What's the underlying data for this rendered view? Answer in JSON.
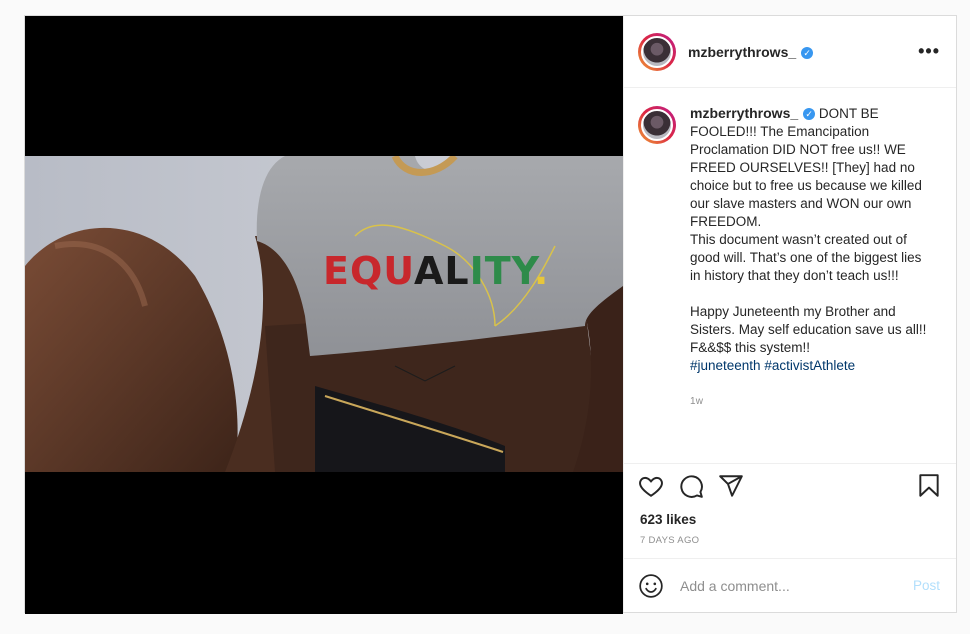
{
  "post": {
    "username": "mzberrythrows_",
    "caption_text": "DONT BE FOOLED!!! The Emancipation Proclamation DID NOT free us!! WE FREED OURSELVES!! [They] had no choice but to free us because we killed our slave masters and WON our own FREEDOM.\nThis document wasn’t created out of good will. That’s one of the biggest lies in history that they don’t teach us!!!\n\nHappy Juneteenth my Brother and Sisters. May self education save us all!! F&&$$ this system!!\n",
    "hashtags": [
      "#juneteenth",
      "#activistAthlete"
    ],
    "time_ago": "1w",
    "likes": "623 likes",
    "date": "7 DAYS AGO",
    "shirt_text": "EQUALITY"
  },
  "comment": {
    "placeholder": "Add a comment...",
    "post_label": "Post"
  },
  "colors": {
    "link": "#00376b",
    "verified": "#3897f0",
    "post_button_disabled": "#b2dffc"
  },
  "icons": [
    "verified-badge-icon",
    "more-options-icon",
    "heart-icon",
    "comment-icon",
    "share-icon",
    "bookmark-icon",
    "emoji-icon"
  ]
}
